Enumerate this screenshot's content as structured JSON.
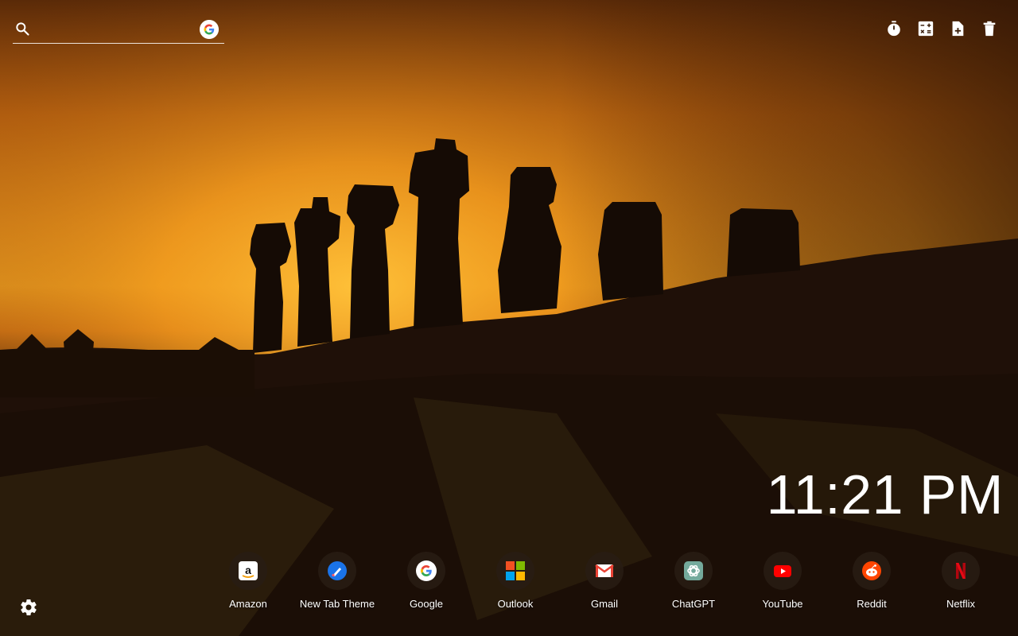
{
  "search": {
    "value": "",
    "placeholder": "",
    "icon": "search-icon",
    "engine_icon": "google-icon"
  },
  "toolbar": {
    "tools": [
      {
        "name": "timer",
        "icon": "timer-icon"
      },
      {
        "name": "calculator",
        "icon": "calculator-icon"
      },
      {
        "name": "new-note",
        "icon": "file-plus-icon"
      },
      {
        "name": "delete",
        "icon": "trash-icon"
      }
    ]
  },
  "clock": {
    "time": "11:21 PM"
  },
  "shortcuts": [
    {
      "label": "Amazon",
      "icon": "amazon-icon"
    },
    {
      "label": "New Tab Theme",
      "icon": "new-tab-theme-icon"
    },
    {
      "label": "Google",
      "icon": "google-icon"
    },
    {
      "label": "Outlook",
      "icon": "microsoft-icon"
    },
    {
      "label": "Gmail",
      "icon": "gmail-icon"
    },
    {
      "label": "ChatGPT",
      "icon": "chatgpt-icon"
    },
    {
      "label": "YouTube",
      "icon": "youtube-icon"
    },
    {
      "label": "Reddit",
      "icon": "reddit-icon"
    },
    {
      "label": "Netflix",
      "icon": "netflix-icon"
    }
  ],
  "settings": {
    "icon": "gear-icon"
  },
  "colors": {
    "text": "#ffffff",
    "sky_top": "#5a2a08",
    "sky_glow": "#f0a020",
    "ground": "#1e1006"
  }
}
